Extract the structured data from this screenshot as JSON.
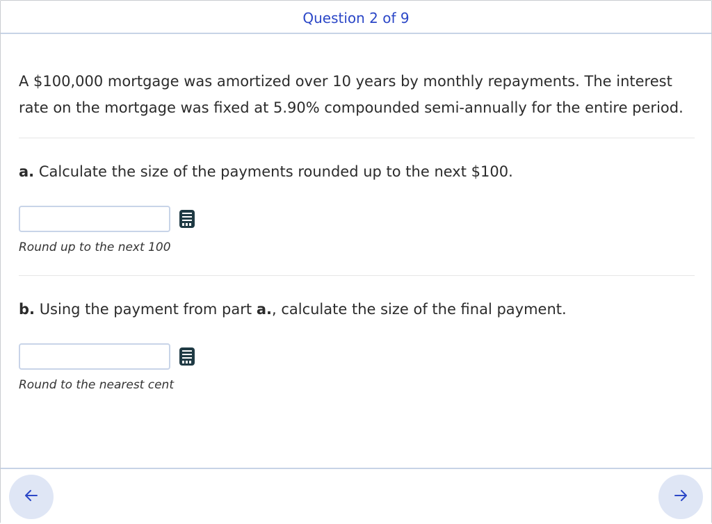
{
  "header": {
    "title": "Question 2 of 9"
  },
  "question": {
    "intro": "A $100,000 mortgage was amortized over 10 years by monthly repayments. The interest rate on the mortgage was fixed at 5.90% compounded semi-annually for the entire period.",
    "parts": [
      {
        "label": "a.",
        "text": " Calculate the size of the payments rounded up to the next $100.",
        "answer_value": "",
        "hint": "Round up to the next 100",
        "icon": "calculator-icon"
      },
      {
        "label": "b.",
        "text_before": " Using the payment from part ",
        "text_bold": "a.",
        "text_after": ", calculate the size of the final payment.",
        "answer_value": "",
        "hint": "Round to the nearest cent",
        "icon": "calculator-icon"
      }
    ]
  },
  "footer": {
    "prev_icon": "arrow-left-icon",
    "next_icon": "arrow-right-icon"
  },
  "colors": {
    "accent": "#2b47c7",
    "header_border": "#c7d3e6",
    "nav_button_bg": "#dfe6f5",
    "input_border": "#c8d4e8",
    "icon_dark": "#1f3a44"
  }
}
